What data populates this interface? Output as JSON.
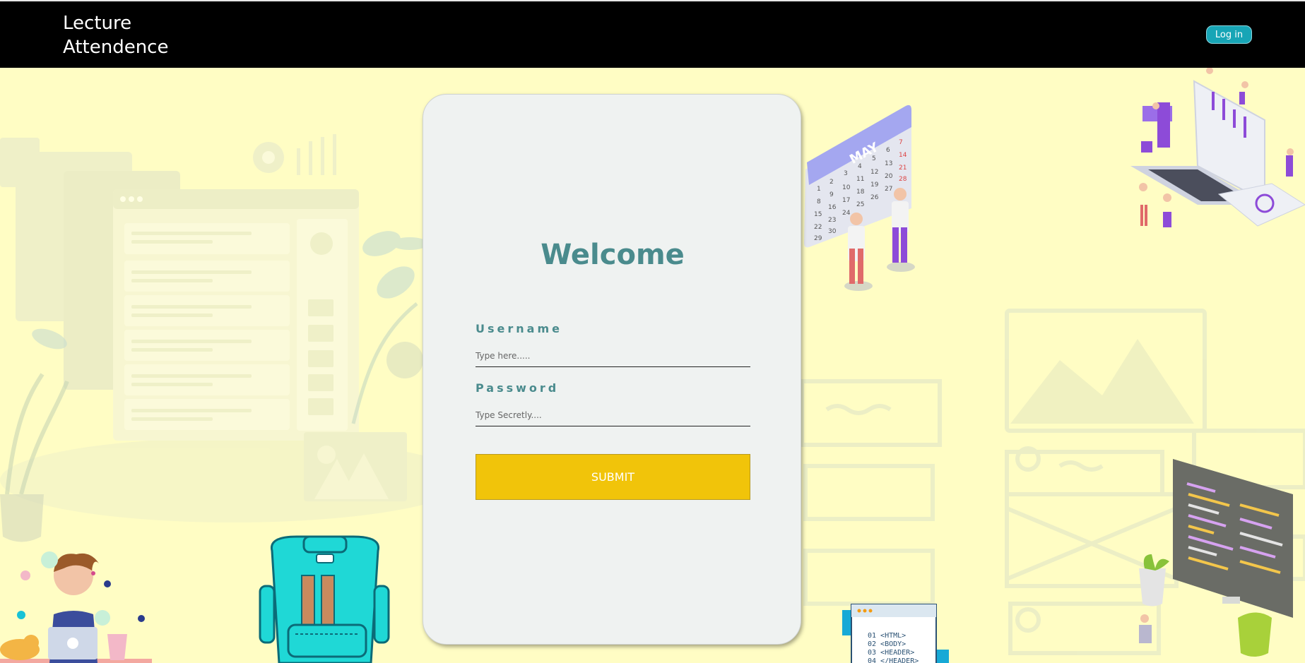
{
  "header": {
    "brand_line1": "Lecture",
    "brand_line2": "Attendence",
    "login_label": "Log in"
  },
  "login_card": {
    "title": "Welcome",
    "username_label": "Username",
    "username_placeholder": "Type here.....",
    "password_label": "Password",
    "password_placeholder": "Type Secretly....",
    "submit_label": "SUBMIT"
  },
  "illustrations": {
    "calendar_month": "MAY",
    "calendar_days": [
      "1",
      "2",
      "3",
      "4",
      "5",
      "6",
      "7",
      "8",
      "9",
      "10",
      "11",
      "12",
      "13",
      "14",
      "15",
      "16",
      "17",
      "18",
      "19",
      "20",
      "21",
      "22",
      "23",
      "24",
      "25",
      "26",
      "27",
      "28",
      "29",
      "30"
    ],
    "code_lines": [
      "01 <HTML>",
      "02 <BODY>",
      "03 <HEADER>",
      "04 </HEADER>"
    ]
  },
  "colors": {
    "page_background": "#fffdc4",
    "header_background": "#000000",
    "accent_teal": "#4a8b8d",
    "login_button": "#17a5b6",
    "submit_button": "#f1c40a",
    "card_background": "#eff2f1"
  }
}
